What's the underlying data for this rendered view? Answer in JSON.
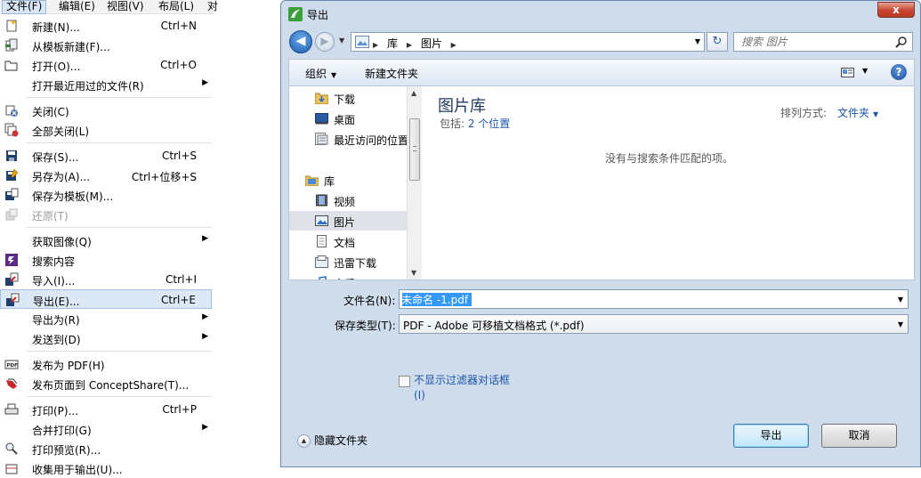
{
  "menubar": {
    "items": [
      "文件(F)",
      "编辑(E)",
      "视图(V)",
      "布局(L)",
      "对"
    ]
  },
  "file_menu": {
    "items": [
      {
        "label": "新建(N)...",
        "shortcut": "Ctrl+N",
        "icon": "new-document-icon"
      },
      {
        "label": "从模板新建(F)...",
        "shortcut": "",
        "icon": "new-from-template-icon"
      },
      {
        "label": "打开(O)...",
        "shortcut": "Ctrl+O",
        "icon": "open-folder-icon"
      },
      {
        "label": "打开最近用过的文件(R)",
        "shortcut": "",
        "icon": ""
      },
      {
        "label": "关闭(C)",
        "shortcut": "",
        "icon": "close-document-icon"
      },
      {
        "label": "全部关闭(L)",
        "shortcut": "",
        "icon": "close-all-icon"
      },
      {
        "label": "保存(S)...",
        "shortcut": "Ctrl+S",
        "icon": "save-icon"
      },
      {
        "label": "另存为(A)...",
        "shortcut": "Ctrl+位移+S",
        "icon": "save-as-icon"
      },
      {
        "label": "保存为模板(M)...",
        "shortcut": "",
        "icon": "save-template-icon"
      },
      {
        "label": "还原(T)",
        "shortcut": "",
        "icon": "revert-icon"
      },
      {
        "label": "获取图像(Q)",
        "shortcut": "",
        "icon": ""
      },
      {
        "label": "搜索内容",
        "shortcut": "",
        "icon": "search-content-icon"
      },
      {
        "label": "导入(I)...",
        "shortcut": "Ctrl+I",
        "icon": "import-icon"
      },
      {
        "label": "导出(E)...",
        "shortcut": "Ctrl+E",
        "icon": "export-icon"
      },
      {
        "label": "导出为(R)",
        "shortcut": "",
        "icon": ""
      },
      {
        "label": "发送到(D)",
        "shortcut": "",
        "icon": ""
      },
      {
        "label": "发布为 PDF(H)",
        "shortcut": "",
        "icon": "pdf-icon"
      },
      {
        "label": "发布页面到 ConceptShare(T)...",
        "shortcut": "",
        "icon": "conceptshare-icon"
      },
      {
        "label": "打印(P)...",
        "shortcut": "Ctrl+P",
        "icon": "print-icon"
      },
      {
        "label": "合并打印(G)",
        "shortcut": "",
        "icon": ""
      },
      {
        "label": "打印预览(R)...",
        "shortcut": "",
        "icon": "print-preview-icon"
      },
      {
        "label": "收集用于输出(U)...",
        "shortcut": "",
        "icon": "collect-output-icon"
      }
    ]
  },
  "dialog": {
    "title": "导出",
    "close_label": "x",
    "address": {
      "crumbs": [
        "库",
        "图片"
      ]
    },
    "search_placeholder": "搜索 图片",
    "toolbar": {
      "organize": "组织",
      "new_folder": "新建文件夹"
    },
    "nav": [
      {
        "label": "下载",
        "icon": "downloads-folder-icon"
      },
      {
        "label": "桌面",
        "icon": "desktop-icon"
      },
      {
        "label": "最近访问的位置",
        "icon": "recent-places-icon"
      },
      {
        "label": "库",
        "icon": "library-icon"
      },
      {
        "label": "视频",
        "icon": "videos-library-icon"
      },
      {
        "label": "图片",
        "icon": "pictures-library-icon"
      },
      {
        "label": "文档",
        "icon": "documents-library-icon"
      },
      {
        "label": "迅雷下载",
        "icon": "xunlei-download-icon"
      },
      {
        "label": "音乐",
        "icon": "music-library-icon"
      }
    ],
    "library": {
      "title": "图片库",
      "includes_prefix": "包括: ",
      "includes_link": "2 个位置",
      "arrange_label": "排列方式:",
      "arrange_value": "文件夹",
      "empty_message": "没有与搜索条件匹配的项。"
    },
    "form": {
      "filename_label": "文件名(N):",
      "filename_value": "未命名 -1.pdf",
      "filetype_label": "保存类型(T):",
      "filetype_value": "PDF - Adobe 可移植文档格式 (*.pdf)",
      "checkbox_label_1": "不显示过滤器对话框",
      "checkbox_label_2": "(I)",
      "hide_folders": "隐藏文件夹",
      "ok": "导出",
      "cancel": "取消"
    }
  }
}
